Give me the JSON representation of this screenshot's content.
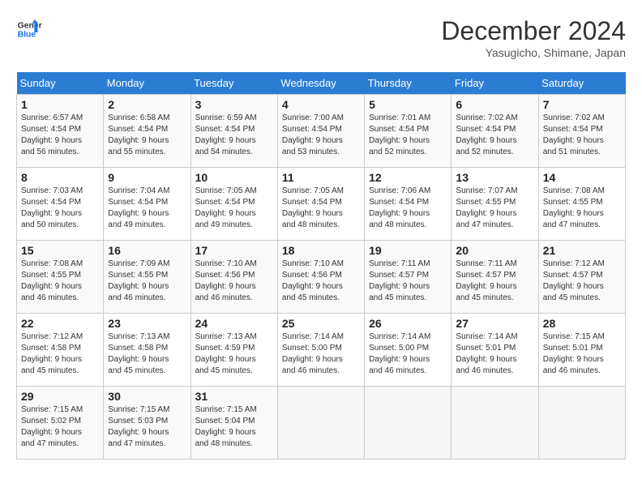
{
  "header": {
    "logo_line1": "General",
    "logo_line2": "Blue",
    "title": "December 2024",
    "subtitle": "Yasugicho, Shimane, Japan"
  },
  "calendar": {
    "days_of_week": [
      "Sunday",
      "Monday",
      "Tuesday",
      "Wednesday",
      "Thursday",
      "Friday",
      "Saturday"
    ],
    "weeks": [
      [
        null,
        null,
        null,
        null,
        null,
        null,
        null
      ]
    ],
    "cells": [
      {
        "day": null
      },
      {
        "day": null
      },
      {
        "day": null
      },
      {
        "day": null
      },
      {
        "day": null
      },
      {
        "day": null
      },
      {
        "day": null
      }
    ],
    "rows": [
      [
        {
          "num": "",
          "info": ""
        },
        {
          "num": "",
          "info": ""
        },
        {
          "num": "",
          "info": ""
        },
        {
          "num": "",
          "info": ""
        },
        {
          "num": "",
          "info": ""
        },
        {
          "num": "",
          "info": ""
        },
        {
          "num": "",
          "info": ""
        }
      ]
    ]
  },
  "days_header": [
    "Sunday",
    "Monday",
    "Tuesday",
    "Wednesday",
    "Thursday",
    "Friday",
    "Saturday"
  ],
  "week1": [
    {
      "num": "1",
      "line1": "Sunrise: 6:57 AM",
      "line2": "Sunset: 4:54 PM",
      "line3": "Daylight: 9 hours",
      "line4": "and 56 minutes."
    },
    {
      "num": "2",
      "line1": "Sunrise: 6:58 AM",
      "line2": "Sunset: 4:54 PM",
      "line3": "Daylight: 9 hours",
      "line4": "and 55 minutes."
    },
    {
      "num": "3",
      "line1": "Sunrise: 6:59 AM",
      "line2": "Sunset: 4:54 PM",
      "line3": "Daylight: 9 hours",
      "line4": "and 54 minutes."
    },
    {
      "num": "4",
      "line1": "Sunrise: 7:00 AM",
      "line2": "Sunset: 4:54 PM",
      "line3": "Daylight: 9 hours",
      "line4": "and 53 minutes."
    },
    {
      "num": "5",
      "line1": "Sunrise: 7:01 AM",
      "line2": "Sunset: 4:54 PM",
      "line3": "Daylight: 9 hours",
      "line4": "and 52 minutes."
    },
    {
      "num": "6",
      "line1": "Sunrise: 7:02 AM",
      "line2": "Sunset: 4:54 PM",
      "line3": "Daylight: 9 hours",
      "line4": "and 52 minutes."
    },
    {
      "num": "7",
      "line1": "Sunrise: 7:02 AM",
      "line2": "Sunset: 4:54 PM",
      "line3": "Daylight: 9 hours",
      "line4": "and 51 minutes."
    }
  ],
  "week2": [
    {
      "num": "8",
      "line1": "Sunrise: 7:03 AM",
      "line2": "Sunset: 4:54 PM",
      "line3": "Daylight: 9 hours",
      "line4": "and 50 minutes."
    },
    {
      "num": "9",
      "line1": "Sunrise: 7:04 AM",
      "line2": "Sunset: 4:54 PM",
      "line3": "Daylight: 9 hours",
      "line4": "and 49 minutes."
    },
    {
      "num": "10",
      "line1": "Sunrise: 7:05 AM",
      "line2": "Sunset: 4:54 PM",
      "line3": "Daylight: 9 hours",
      "line4": "and 49 minutes."
    },
    {
      "num": "11",
      "line1": "Sunrise: 7:05 AM",
      "line2": "Sunset: 4:54 PM",
      "line3": "Daylight: 9 hours",
      "line4": "and 48 minutes."
    },
    {
      "num": "12",
      "line1": "Sunrise: 7:06 AM",
      "line2": "Sunset: 4:54 PM",
      "line3": "Daylight: 9 hours",
      "line4": "and 48 minutes."
    },
    {
      "num": "13",
      "line1": "Sunrise: 7:07 AM",
      "line2": "Sunset: 4:55 PM",
      "line3": "Daylight: 9 hours",
      "line4": "and 47 minutes."
    },
    {
      "num": "14",
      "line1": "Sunrise: 7:08 AM",
      "line2": "Sunset: 4:55 PM",
      "line3": "Daylight: 9 hours",
      "line4": "and 47 minutes."
    }
  ],
  "week3": [
    {
      "num": "15",
      "line1": "Sunrise: 7:08 AM",
      "line2": "Sunset: 4:55 PM",
      "line3": "Daylight: 9 hours",
      "line4": "and 46 minutes."
    },
    {
      "num": "16",
      "line1": "Sunrise: 7:09 AM",
      "line2": "Sunset: 4:55 PM",
      "line3": "Daylight: 9 hours",
      "line4": "and 46 minutes."
    },
    {
      "num": "17",
      "line1": "Sunrise: 7:10 AM",
      "line2": "Sunset: 4:56 PM",
      "line3": "Daylight: 9 hours",
      "line4": "and 46 minutes."
    },
    {
      "num": "18",
      "line1": "Sunrise: 7:10 AM",
      "line2": "Sunset: 4:56 PM",
      "line3": "Daylight: 9 hours",
      "line4": "and 45 minutes."
    },
    {
      "num": "19",
      "line1": "Sunrise: 7:11 AM",
      "line2": "Sunset: 4:57 PM",
      "line3": "Daylight: 9 hours",
      "line4": "and 45 minutes."
    },
    {
      "num": "20",
      "line1": "Sunrise: 7:11 AM",
      "line2": "Sunset: 4:57 PM",
      "line3": "Daylight: 9 hours",
      "line4": "and 45 minutes."
    },
    {
      "num": "21",
      "line1": "Sunrise: 7:12 AM",
      "line2": "Sunset: 4:57 PM",
      "line3": "Daylight: 9 hours",
      "line4": "and 45 minutes."
    }
  ],
  "week4": [
    {
      "num": "22",
      "line1": "Sunrise: 7:12 AM",
      "line2": "Sunset: 4:58 PM",
      "line3": "Daylight: 9 hours",
      "line4": "and 45 minutes."
    },
    {
      "num": "23",
      "line1": "Sunrise: 7:13 AM",
      "line2": "Sunset: 4:58 PM",
      "line3": "Daylight: 9 hours",
      "line4": "and 45 minutes."
    },
    {
      "num": "24",
      "line1": "Sunrise: 7:13 AM",
      "line2": "Sunset: 4:59 PM",
      "line3": "Daylight: 9 hours",
      "line4": "and 45 minutes."
    },
    {
      "num": "25",
      "line1": "Sunrise: 7:14 AM",
      "line2": "Sunset: 5:00 PM",
      "line3": "Daylight: 9 hours",
      "line4": "and 46 minutes."
    },
    {
      "num": "26",
      "line1": "Sunrise: 7:14 AM",
      "line2": "Sunset: 5:00 PM",
      "line3": "Daylight: 9 hours",
      "line4": "and 46 minutes."
    },
    {
      "num": "27",
      "line1": "Sunrise: 7:14 AM",
      "line2": "Sunset: 5:01 PM",
      "line3": "Daylight: 9 hours",
      "line4": "and 46 minutes."
    },
    {
      "num": "28",
      "line1": "Sunrise: 7:15 AM",
      "line2": "Sunset: 5:01 PM",
      "line3": "Daylight: 9 hours",
      "line4": "and 46 minutes."
    }
  ],
  "week5": [
    {
      "num": "29",
      "line1": "Sunrise: 7:15 AM",
      "line2": "Sunset: 5:02 PM",
      "line3": "Daylight: 9 hours",
      "line4": "and 47 minutes."
    },
    {
      "num": "30",
      "line1": "Sunrise: 7:15 AM",
      "line2": "Sunset: 5:03 PM",
      "line3": "Daylight: 9 hours",
      "line4": "and 47 minutes."
    },
    {
      "num": "31",
      "line1": "Sunrise: 7:15 AM",
      "line2": "Sunset: 5:04 PM",
      "line3": "Daylight: 9 hours",
      "line4": "and 48 minutes."
    },
    {
      "num": "",
      "line1": "",
      "line2": "",
      "line3": "",
      "line4": ""
    },
    {
      "num": "",
      "line1": "",
      "line2": "",
      "line3": "",
      "line4": ""
    },
    {
      "num": "",
      "line1": "",
      "line2": "",
      "line3": "",
      "line4": ""
    },
    {
      "num": "",
      "line1": "",
      "line2": "",
      "line3": "",
      "line4": ""
    }
  ]
}
